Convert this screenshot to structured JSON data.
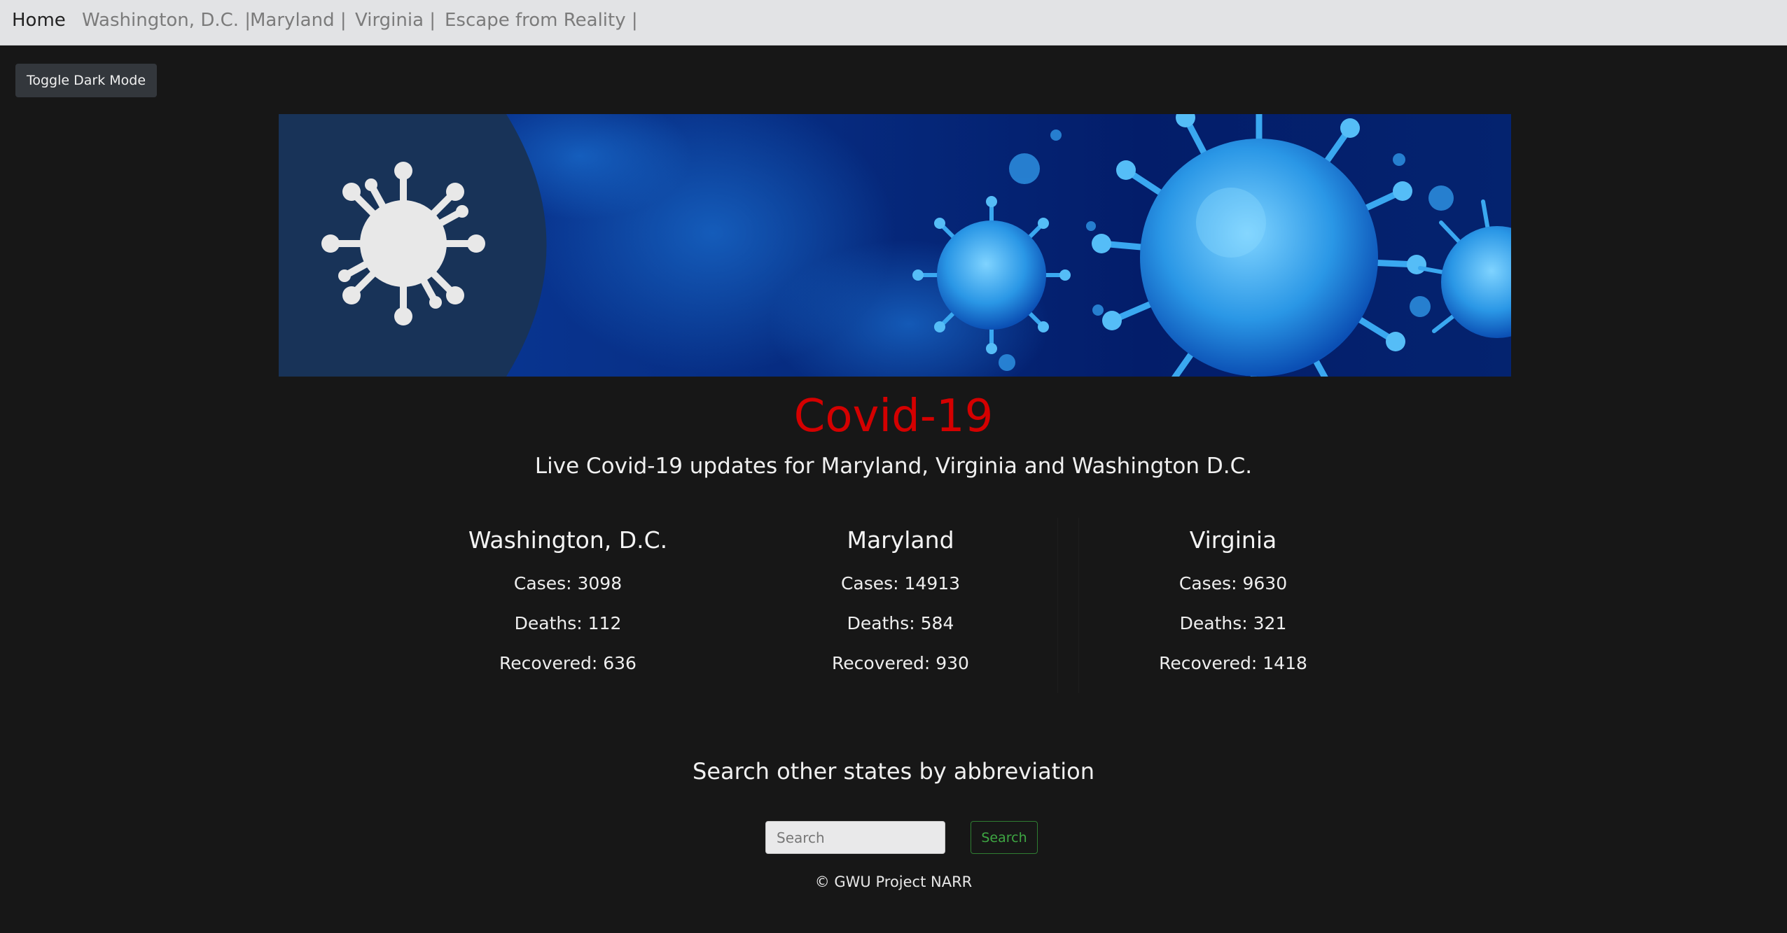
{
  "nav": {
    "home": "Home",
    "dc": "Washington, D.C. |",
    "md": "Maryland |",
    "va": "Virginia |",
    "escape": "Escape from Reality |"
  },
  "toggle_label": "Toggle Dark Mode",
  "banner": {
    "icon": "virus-icon",
    "colors": {
      "panel": "#183358",
      "deep": "#041a6b",
      "bright": "#1f8ad8"
    }
  },
  "title": "Covid-19",
  "subtitle": "Live Covid-19 updates for Maryland, Virginia and Washington D.C.",
  "states": [
    {
      "name": "Washington, D.C.",
      "cases_label": "Cases",
      "cases": "3098",
      "deaths_label": "Deaths",
      "deaths": "112",
      "recovered_label": "Recovered",
      "recovered": "636"
    },
    {
      "name": "Maryland",
      "cases_label": "Cases",
      "cases": "14913",
      "deaths_label": "Deaths",
      "deaths": "584",
      "recovered_label": "Recovered",
      "recovered": "930"
    },
    {
      "name": "Virginia",
      "cases_label": "Cases",
      "cases": "9630",
      "deaths_label": "Deaths",
      "deaths": "321",
      "recovered_label": "Recovered",
      "recovered": "1418"
    }
  ],
  "search": {
    "heading": "Search other states by abbreviation",
    "placeholder": "Search",
    "value": "",
    "button_label": "Search"
  },
  "footer": "© GWU Project NARR",
  "colors": {
    "background": "#171717",
    "navbar": "#e2e3e5",
    "title": "#d40000",
    "search_button": "#3ea743"
  }
}
